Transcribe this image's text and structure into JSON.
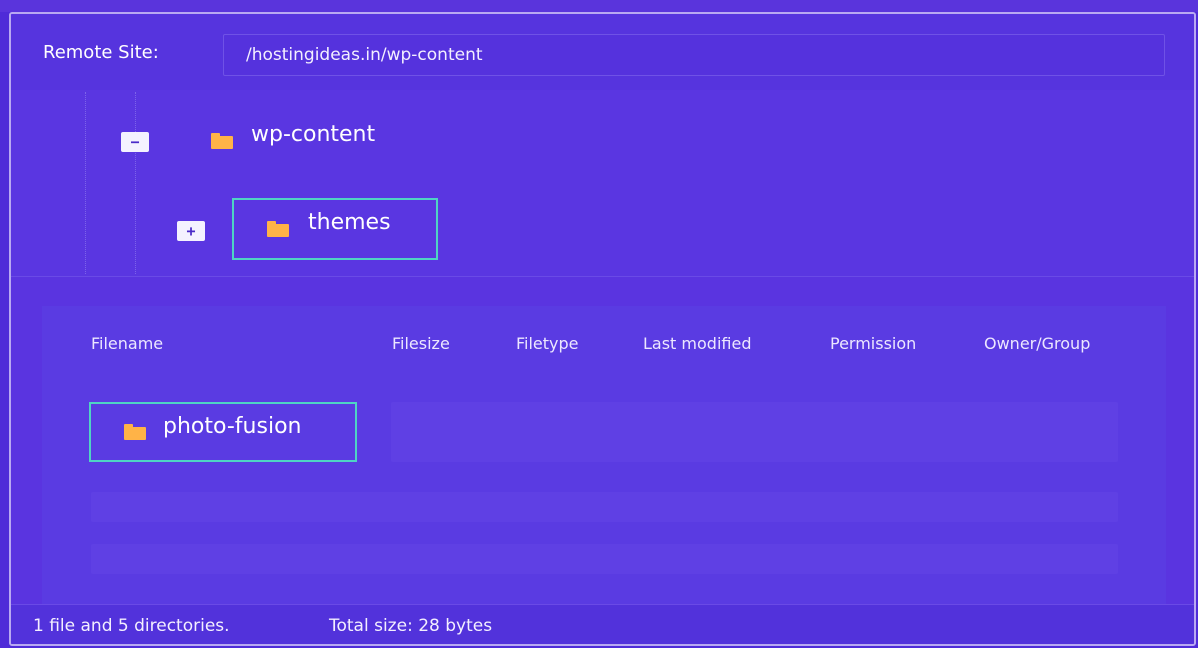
{
  "remote_site": {
    "label": "Remote Site:",
    "path": "/hostingideas.in/wp-content"
  },
  "tree": {
    "root": {
      "toggle": "−",
      "label": "wp-content",
      "icon": "folder-icon",
      "expanded": true
    },
    "child": {
      "toggle": "+",
      "label": "themes",
      "icon": "folder-icon",
      "expanded": false,
      "selected": true
    }
  },
  "file_list": {
    "columns": [
      "Filename",
      "Filesize",
      "Filetype",
      "Last modified",
      "Permission",
      "Owner/Group"
    ],
    "rows": [
      {
        "filename": "photo-fusion",
        "icon": "folder-icon",
        "selected": true
      }
    ]
  },
  "status": {
    "summary": "1 file and 5 directories.",
    "total": "Total size: 28 bytes"
  },
  "colors": {
    "background": "#4f2bd8",
    "panel": "#5a34e0",
    "highlight": "#4fd3c4",
    "folder": "#ffb347"
  }
}
